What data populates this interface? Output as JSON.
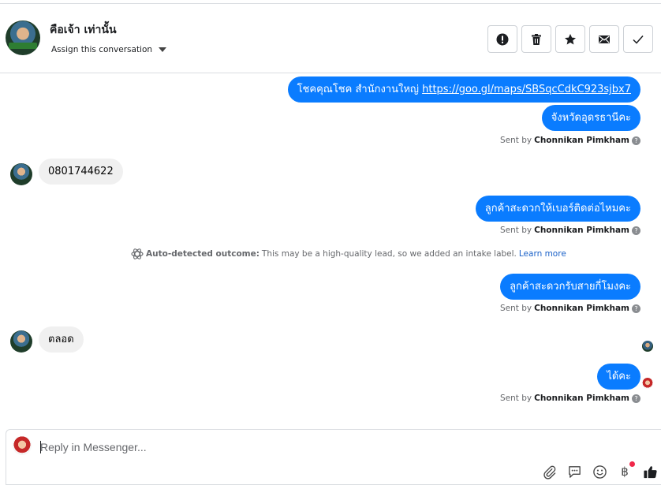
{
  "header": {
    "contact_name": "คือเจ้า เท่านั้น",
    "assign_label": "Assign this conversation",
    "actions": [
      {
        "name": "mark-spam-button",
        "icon": "alert-circle-icon"
      },
      {
        "name": "delete-button",
        "icon": "trash-icon"
      },
      {
        "name": "star-button",
        "icon": "star-icon"
      },
      {
        "name": "mark-unread-button",
        "icon": "envelope-icon"
      },
      {
        "name": "mark-done-button",
        "icon": "check-icon"
      }
    ]
  },
  "messages": {
    "m1_text": "โชคคุณโชค สำนักงานใหญ่ ",
    "m1_link": "https://goo.gl/maps/SBSqcCdkC923sjbx7",
    "m2": "จังหวัดอุดรธานีคะ",
    "m3": "0801744622",
    "m4": "ลูกค้าสะดวกให้เบอร์ติดต่อไหมคะ",
    "m5": "ลูกค้าสะดวกรับสายกี่โมงคะ",
    "m6": "ตลอด",
    "m7": "ได้คะ"
  },
  "sent_by": {
    "prefix": "Sent by",
    "agent": "Chonnikan Pimkham",
    "help": "?"
  },
  "outcome": {
    "title": "Auto-detected outcome:",
    "text": "This may be a high-quality lead, so we added an intake label.",
    "link": "Learn more"
  },
  "composer": {
    "placeholder": "Reply in Messenger...",
    "tools": [
      "paperclip-icon",
      "saved-reply-icon",
      "emoji-icon",
      "baht-payment-icon",
      "thumbs-up-icon"
    ],
    "baht_glyph": "฿"
  },
  "colors": {
    "outgoing_bubble": "#0a7cff",
    "incoming_bubble": "#f0f0f0",
    "link": "#1a61c8",
    "notification_dot": "#f02849"
  }
}
